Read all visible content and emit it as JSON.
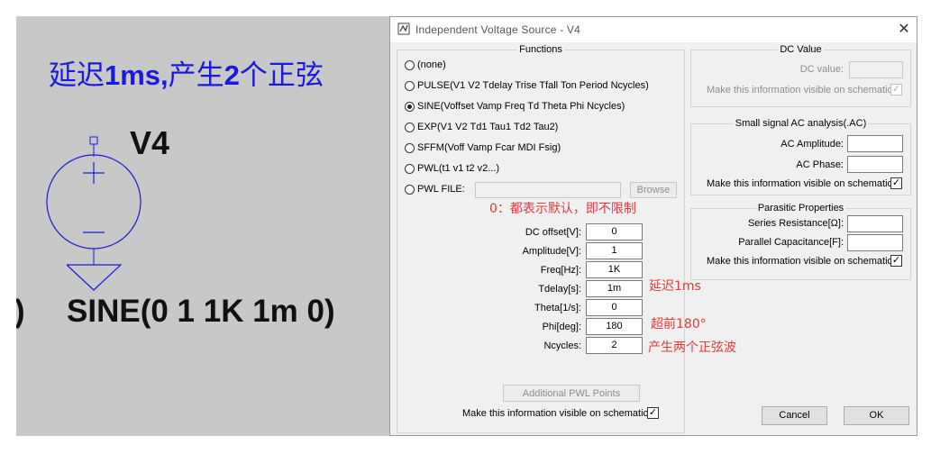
{
  "schematic": {
    "title_a": "延迟",
    "title_b": "1ms,",
    "title_c": "产生",
    "title_d": "2",
    "title_e": "个正弦",
    "source_name": "V4",
    "source_value": "SINE(0 1 1K 1m 0)",
    "left_fragment": ")"
  },
  "dialog": {
    "title": "Independent Voltage Source - V4",
    "close_label": "✕",
    "functions": {
      "legend": "Functions",
      "options": [
        {
          "label": "(none)",
          "selected": false
        },
        {
          "label": "PULSE(V1 V2 Tdelay Trise Tfall Ton Period Ncycles)",
          "selected": false
        },
        {
          "label": "SINE(Voffset Vamp Freq Td Theta Phi Ncycles)",
          "selected": true
        },
        {
          "label": "EXP(V1 V2 Td1 Tau1 Td2 Tau2)",
          "selected": false
        },
        {
          "label": "SFFM(Voff Vamp Fcar MDI Fsig)",
          "selected": false
        },
        {
          "label": "PWL(t1 v1 t2 v2...)",
          "selected": false
        },
        {
          "label": "PWL FILE:",
          "selected": false
        }
      ],
      "browse_label": "Browse"
    },
    "params": [
      {
        "label": "DC offset[V]:",
        "value": "0"
      },
      {
        "label": "Amplitude[V]:",
        "value": "1"
      },
      {
        "label": "Freq[Hz]:",
        "value": "1K"
      },
      {
        "label": "Tdelay[s]:",
        "value": "1m"
      },
      {
        "label": "Theta[1/s]:",
        "value": "0"
      },
      {
        "label": "Phi[deg]:",
        "value": "180"
      },
      {
        "label": "Ncycles:",
        "value": "2"
      }
    ],
    "additional_pwl_label": "Additional PWL Points",
    "visible_on_schematic_label": "Make this information visible on schematic:",
    "dc_value": {
      "legend": "DC Value",
      "dc_label": "DC value:",
      "visible_label": "Make this information visible on schematic:"
    },
    "small_signal": {
      "legend": "Small signal AC analysis(.AC)",
      "ac_amplitude_label": "AC Amplitude:",
      "ac_phase_label": "AC Phase:",
      "visible_label": "Make this information visible on schematic:"
    },
    "parasitic": {
      "legend": "Parasitic Properties",
      "series_res_label": "Series Resistance[Ω]:",
      "parallel_cap_label": "Parallel Capacitance[F]:",
      "visible_label": "Make this information visible on schematic:"
    },
    "cancel_label": "Cancel",
    "ok_label": "OK",
    "check_mark": "✓"
  },
  "annotations": {
    "default_note": "0：都表示默认，即不限制",
    "delay_note": "延迟1ms",
    "phase_note": "超前180°",
    "cycles_note": "产生两个正弦波"
  },
  "colors": {
    "schematic_bg": "#c8c8c8",
    "schematic_text": "#1a1adc",
    "annotation": "#e8383d"
  }
}
